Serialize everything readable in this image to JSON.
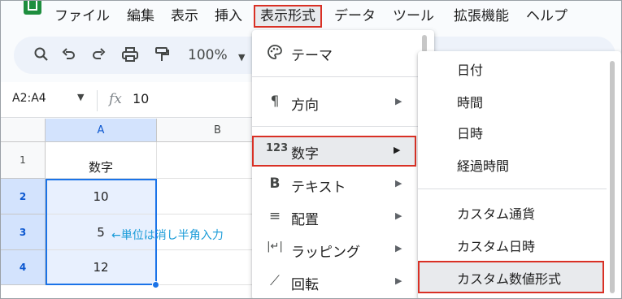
{
  "menubar": {
    "items": [
      "ファイル",
      "編集",
      "表示",
      "挿入",
      "表示形式",
      "データ",
      "ツール",
      "拡張機能",
      "ヘルプ"
    ]
  },
  "toolbar": {
    "zoom": "100%"
  },
  "namebar": {
    "range": "A2:A4",
    "fx": "fx",
    "formula": "10"
  },
  "grid": {
    "columns": [
      "A",
      "B"
    ],
    "rows": [
      {
        "num": "1",
        "a": "数字"
      },
      {
        "num": "2",
        "a": "10"
      },
      {
        "num": "3",
        "a": "5"
      },
      {
        "num": "4",
        "a": "12"
      }
    ],
    "annotation": "←単位は消し半角入力"
  },
  "format_menu": {
    "items": [
      {
        "icon": "palette-icon",
        "glyph": "🎨",
        "label": "テーマ",
        "arrow": ""
      },
      {
        "icon": "text-direction-icon",
        "glyph": "¶",
        "label": "方向",
        "arrow": "▶"
      },
      {
        "icon": "number-123-icon",
        "glyph": "123",
        "label": "数字",
        "arrow": "▶"
      },
      {
        "icon": "bold-icon",
        "glyph": "B",
        "label": "テキスト",
        "arrow": "▶"
      },
      {
        "icon": "align-icon",
        "glyph": "≡",
        "label": "配置",
        "arrow": "▶"
      },
      {
        "icon": "wrap-icon",
        "glyph": "|↵|",
        "label": "ラッピング",
        "arrow": "▶"
      },
      {
        "icon": "rotate-icon",
        "glyph": "⟋",
        "label": "回転",
        "arrow": "▶"
      }
    ]
  },
  "number_submenu": {
    "items": [
      "日付",
      "時間",
      "日時",
      "経過時間",
      "カスタム通貨",
      "カスタム日時",
      "カスタム数値形式"
    ]
  }
}
